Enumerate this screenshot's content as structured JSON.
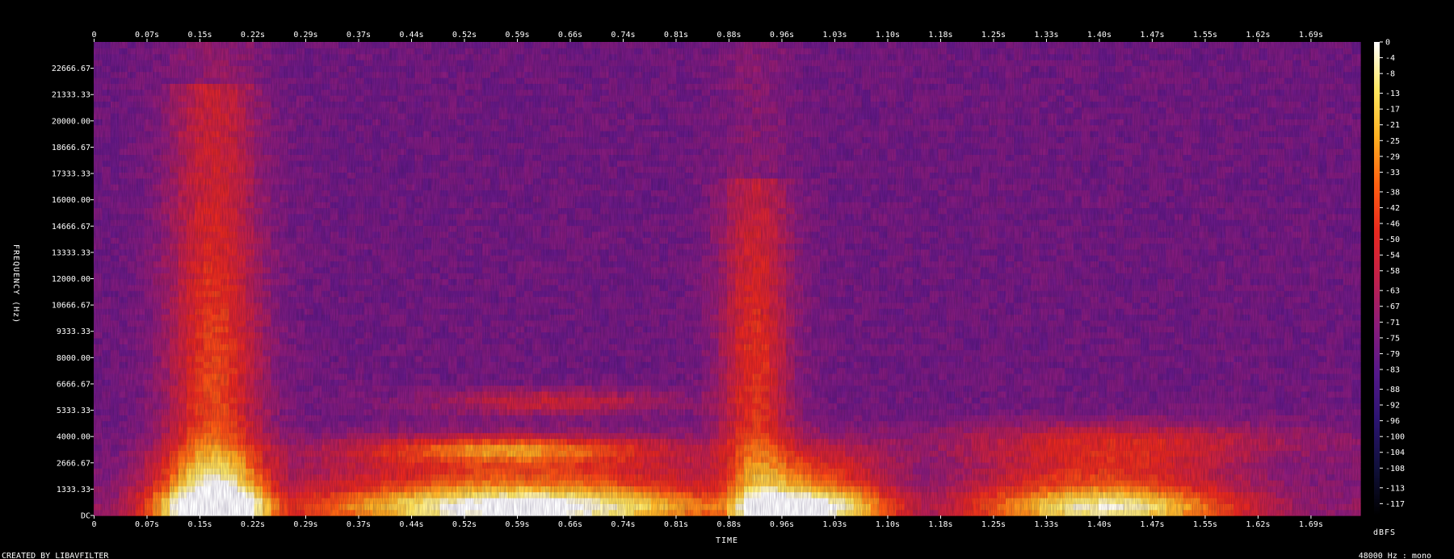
{
  "footer": {
    "left": "CREATED BY LIBAVFILTER",
    "right": "48000 Hz : mono"
  },
  "chart_data": {
    "type": "heatmap",
    "title": "",
    "xlabel": "TIME",
    "ylabel": "FREQUENCY (Hz)",
    "colorbar_label": "dBFS",
    "x_ticks": [
      "0",
      "0.07s",
      "0.15s",
      "0.22s",
      "0.29s",
      "0.37s",
      "0.44s",
      "0.52s",
      "0.59s",
      "0.66s",
      "0.74s",
      "0.81s",
      "0.88s",
      "0.96s",
      "1.03s",
      "1.10s",
      "1.18s",
      "1.25s",
      "1.33s",
      "1.40s",
      "1.47s",
      "1.55s",
      "1.62s",
      "1.69s"
    ],
    "y_ticks": [
      "DC",
      "1333.33",
      "2666.67",
      "4000.00",
      "5333.33",
      "6666.67",
      "8000.00",
      "9333.33",
      "10666.67",
      "12000.00",
      "13333.33",
      "14666.67",
      "16000.00",
      "17333.33",
      "18666.67",
      "20000.00",
      "21333.33",
      "22666.67"
    ],
    "y_tick_values": [
      0,
      1333.33,
      2666.67,
      4000,
      5333.33,
      6666.67,
      8000,
      9333.33,
      10666.67,
      12000,
      13333.33,
      14666.67,
      16000,
      17333.33,
      18666.67,
      20000,
      21333.33,
      22666.67
    ],
    "y_range_hz": [
      0,
      24000
    ],
    "x_range_s": [
      0,
      1.78
    ],
    "colorbar_ticks": [
      "0",
      "-4",
      "-8",
      "-13",
      "-17",
      "-21",
      "-25",
      "-29",
      "-33",
      "-38",
      "-42",
      "-46",
      "-50",
      "-54",
      "-58",
      "-63",
      "-67",
      "-71",
      "-75",
      "-79",
      "-83",
      "-88",
      "-92",
      "-96",
      "-100",
      "-104",
      "-108",
      "-113",
      "-117"
    ],
    "colorbar_range_db": [
      -120,
      0
    ],
    "colormap": [
      "#000000",
      "#10103a",
      "#2a1470",
      "#54188a",
      "#8a1c7a",
      "#c0204a",
      "#e8281e",
      "#ff6010",
      "#ffb020",
      "#ffe860",
      "#ffffff"
    ],
    "sample_rate": "48000 Hz",
    "channels": "mono"
  }
}
